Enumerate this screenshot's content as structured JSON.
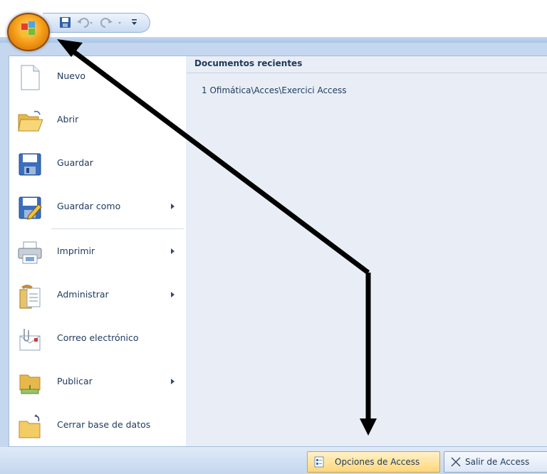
{
  "quick_access": {
    "icons": [
      "save-icon",
      "undo-icon",
      "redo-icon",
      "customize-icon"
    ]
  },
  "office_button": {
    "icon": "office-logo"
  },
  "menu": {
    "items": [
      {
        "label": "Nuevo",
        "icon": "new-document-icon",
        "has_submenu": false
      },
      {
        "label": "Abrir",
        "icon": "open-folder-icon",
        "has_submenu": false
      },
      {
        "label": "Guardar",
        "icon": "save-icon",
        "has_submenu": false
      },
      {
        "label": "Guardar como",
        "icon": "save-as-icon",
        "has_submenu": true
      },
      {
        "label": "Imprimir",
        "icon": "printer-icon",
        "has_submenu": true
      },
      {
        "label": "Administrar",
        "icon": "manage-icon",
        "has_submenu": true
      },
      {
        "label": "Correo electrónico",
        "icon": "email-icon",
        "has_submenu": false
      },
      {
        "label": "Publicar",
        "icon": "publish-icon",
        "has_submenu": true
      },
      {
        "label": "Cerrar base de datos",
        "icon": "close-database-icon",
        "has_submenu": false
      }
    ]
  },
  "recent": {
    "title": "Documentos recientes",
    "items": [
      "1 Ofimática\\Acces\\Exercici Access"
    ]
  },
  "bottom": {
    "options_label": "Opciones de Access",
    "exit_label": "Salir de Access"
  },
  "colors": {
    "accent": "#c4d7ee",
    "office_button": "#f7a21a",
    "options_button": "#ffd779",
    "annotation_arrow": "#000000"
  }
}
